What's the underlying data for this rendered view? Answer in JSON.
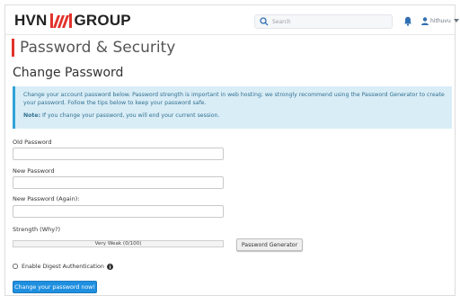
{
  "brand": {
    "name_left": "HVN",
    "name_right": "GROUP",
    "accent_color": "#e2332b"
  },
  "header": {
    "search_placeholder": "Search",
    "user_name": "hithuvu"
  },
  "page": {
    "title": "Password & Security",
    "section_title": "Change Password"
  },
  "alert": {
    "text": "Change your account password below. Password strength is important in web hosting; we strongly recommend using the Password Generator to create your password. Follow the tips below to keep your password safe.",
    "note_label": "Note:",
    "note_text": "If you change your password, you will end your current session."
  },
  "form": {
    "old_password_label": "Old Password",
    "old_password_value": "",
    "new_password_label": "New Password",
    "new_password_value": "",
    "new_password_again_label": "New Password (Again):",
    "new_password_again_value": "",
    "strength_label": "Strength (Why?)",
    "strength_value": "Very Weak (0/100)",
    "generator_button": "Password Generator",
    "digest_label": "Enable Digest Authentication",
    "submit_button": "Change your password now!"
  },
  "colors": {
    "alert_bg": "#d9edf7",
    "alert_border": "#31a2d8",
    "primary_button": "#1f8fe0"
  }
}
